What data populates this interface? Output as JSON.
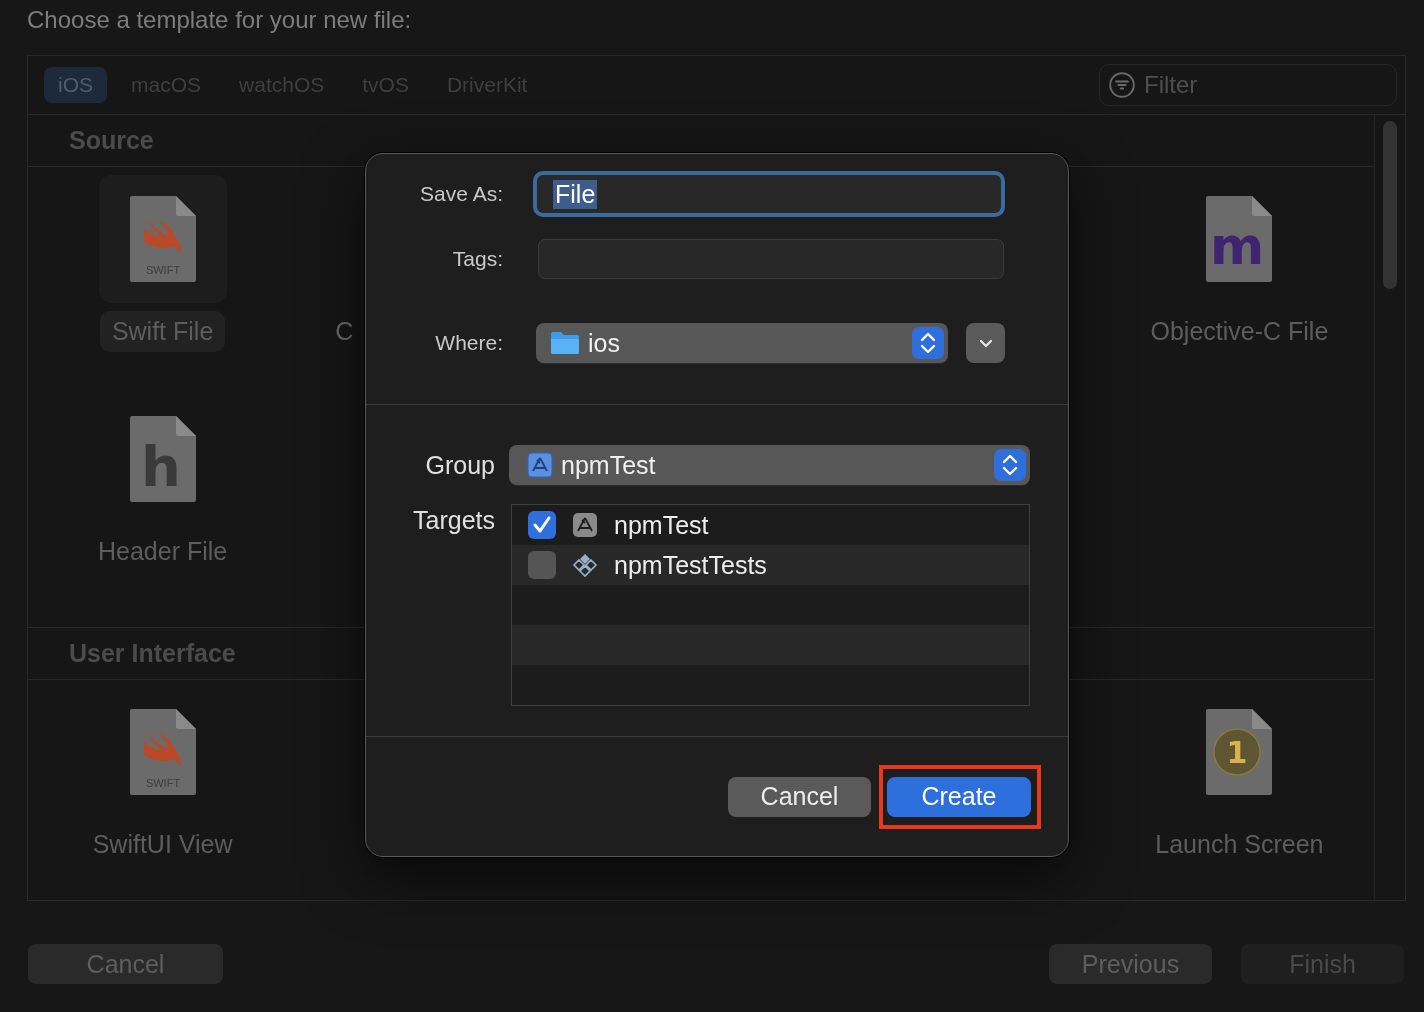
{
  "heading": "Choose a template for your new file:",
  "platform_tabs": [
    {
      "label": "iOS",
      "selected": true
    },
    {
      "label": "macOS",
      "selected": false
    },
    {
      "label": "watchOS",
      "selected": false
    },
    {
      "label": "tvOS",
      "selected": false
    },
    {
      "label": "DriverKit",
      "selected": false
    }
  ],
  "filter": {
    "placeholder": "Filter"
  },
  "sections": [
    {
      "title": "Source",
      "rows": [
        [
          {
            "kind": "swift",
            "glyph": "SWIFT",
            "label": "Swift File",
            "selected": true
          },
          {
            "kind": "partial",
            "label": "C"
          },
          {
            "kind": "objc",
            "glyph": "m",
            "label": "Objective-C File",
            "selected": false
          }
        ],
        [
          {
            "kind": "header",
            "glyph": "h",
            "label": "Header File",
            "selected": false
          }
        ]
      ]
    },
    {
      "title": "User Interface",
      "rows": [
        [
          {
            "kind": "swift",
            "glyph": "SWIFT",
            "label": "SwiftUI View",
            "selected": false
          },
          {
            "kind": "launch",
            "glyph": "1",
            "label": "Launch Screen",
            "selected": false
          }
        ]
      ]
    }
  ],
  "footer_buttons": [
    {
      "label": "Cancel",
      "disabled": false
    },
    {
      "label": "Previous",
      "disabled": false
    },
    {
      "label": "Finish",
      "disabled": true
    }
  ],
  "dialog": {
    "save_as": {
      "label": "Save As:",
      "value": "File"
    },
    "tags": {
      "label": "Tags:"
    },
    "where": {
      "label": "Where:",
      "value": "ios"
    },
    "group": {
      "label": "Group",
      "value": "npmTest"
    },
    "targets": {
      "label": "Targets",
      "items": [
        {
          "name": "npmTest",
          "kind": "app",
          "checked": true
        },
        {
          "name": "npmTestTests",
          "kind": "tests",
          "checked": false
        }
      ]
    },
    "buttons": [
      {
        "label": "Cancel",
        "default": false,
        "highlighted": false
      },
      {
        "label": "Create",
        "default": true,
        "highlighted": true
      }
    ]
  }
}
